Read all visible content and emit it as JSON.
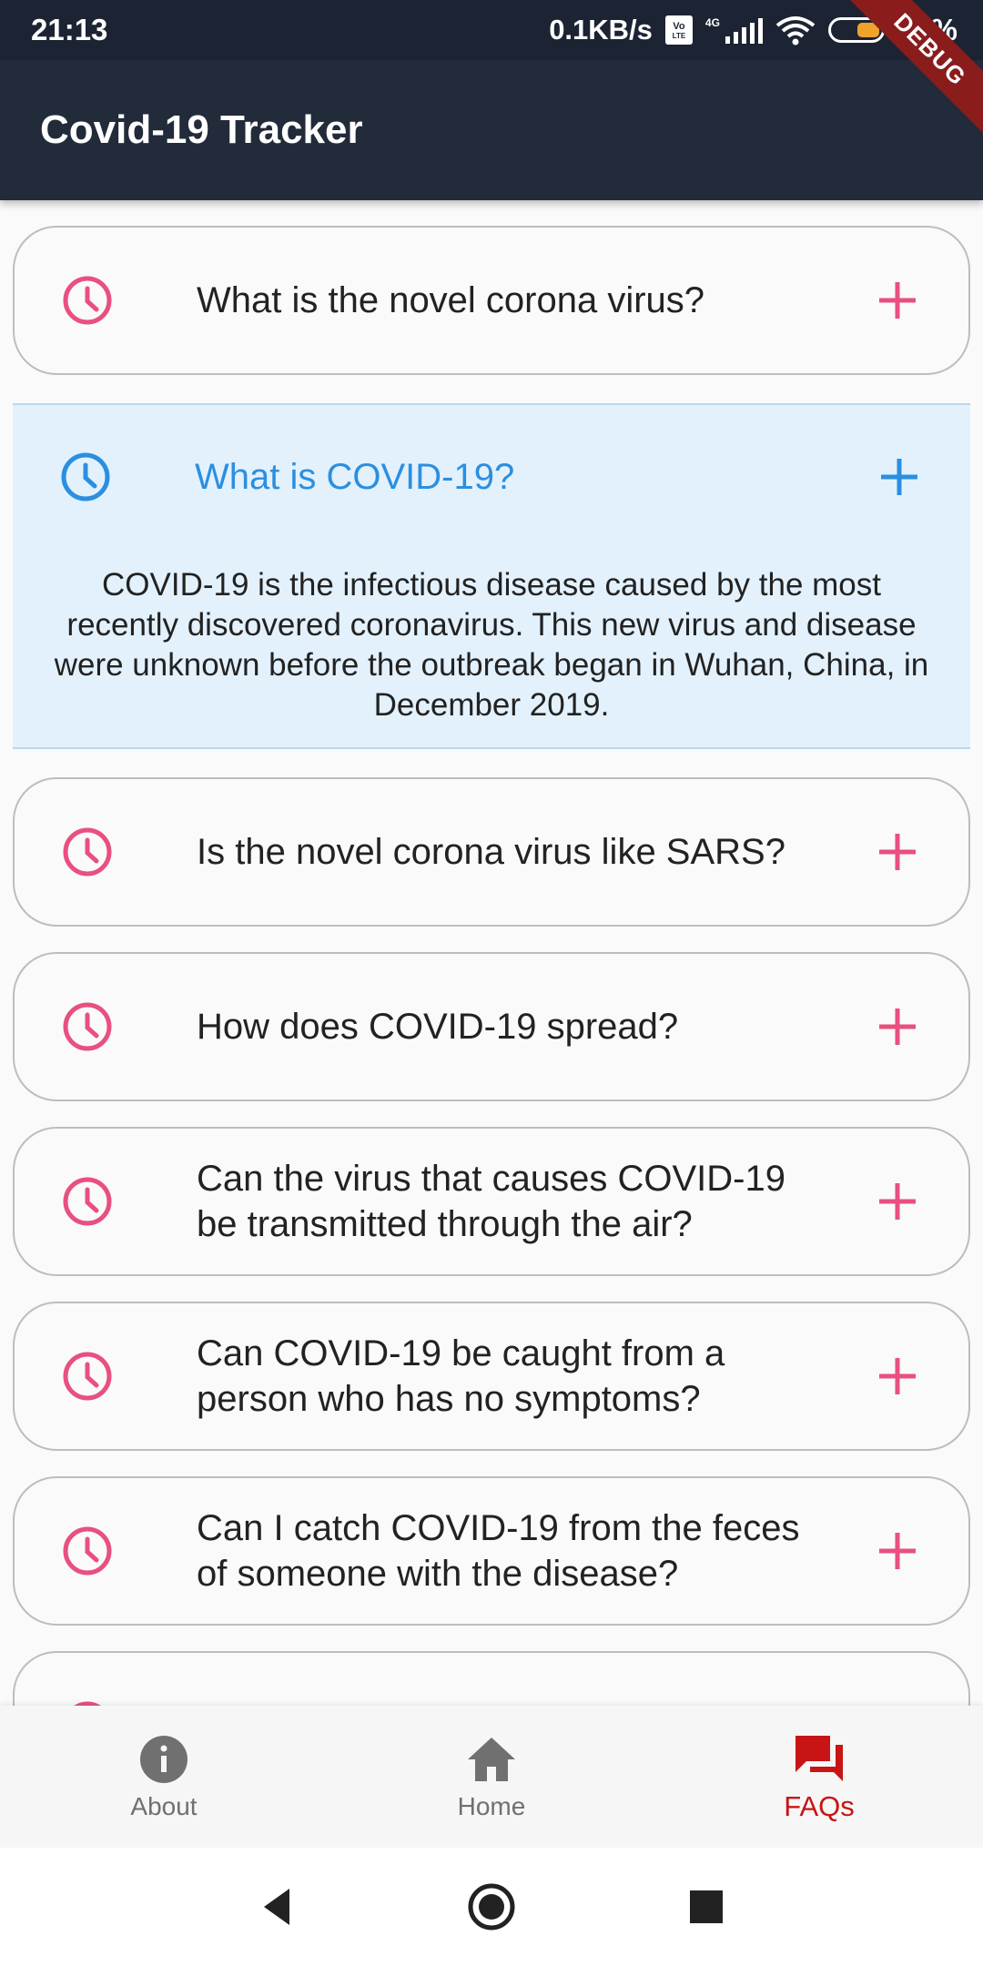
{
  "status_bar": {
    "time": "21:13",
    "speed": "0.1KB/s",
    "volte": "Vo",
    "volte_sub": "LTE",
    "network": "4G",
    "battery": "44%"
  },
  "debug_banner": "DEBUG",
  "app_bar": {
    "title": "Covid-19 Tracker"
  },
  "colors": {
    "accent_pink": "#e8507f",
    "accent_blue": "#2b8fe0",
    "active_nav": "#c81414",
    "appbar_bg": "#222b3a"
  },
  "faqs": [
    {
      "question": "What is the novel corona virus?",
      "icon": "clock-icon",
      "action_icon": "plus-icon"
    },
    {
      "question": "What is COVID-19?",
      "icon": "clock-icon",
      "action_icon": "plus-icon",
      "expanded": true,
      "answer": "COVID-19 is the infectious disease caused by the most recently discovered coronavirus. This new virus and disease were unknown before the outbreak began in Wuhan, China, in December 2019."
    },
    {
      "question": "Is the novel corona virus like SARS?",
      "icon": "clock-icon",
      "action_icon": "plus-icon"
    },
    {
      "question": "How does COVID-19 spread?",
      "icon": "clock-icon",
      "action_icon": "plus-icon"
    },
    {
      "question": "Can the virus that causes COVID-19 be transmitted through the air?",
      "icon": "clock-icon",
      "action_icon": "plus-icon"
    },
    {
      "question": "Can COVID-19 be caught from a person who has no symptoms?",
      "icon": "clock-icon",
      "action_icon": "plus-icon"
    },
    {
      "question": "Can I catch COVID-19 from the feces of someone with the disease?",
      "icon": "clock-icon",
      "action_icon": "plus-icon"
    }
  ],
  "bottom_nav": {
    "items": [
      {
        "label": "About",
        "icon": "info-icon"
      },
      {
        "label": "Home",
        "icon": "home-icon"
      },
      {
        "label": "FAQs",
        "icon": "forum-icon",
        "active": true
      }
    ]
  },
  "system_nav": {
    "back": "back-icon",
    "home": "home-circle-icon",
    "recents": "recents-icon"
  }
}
